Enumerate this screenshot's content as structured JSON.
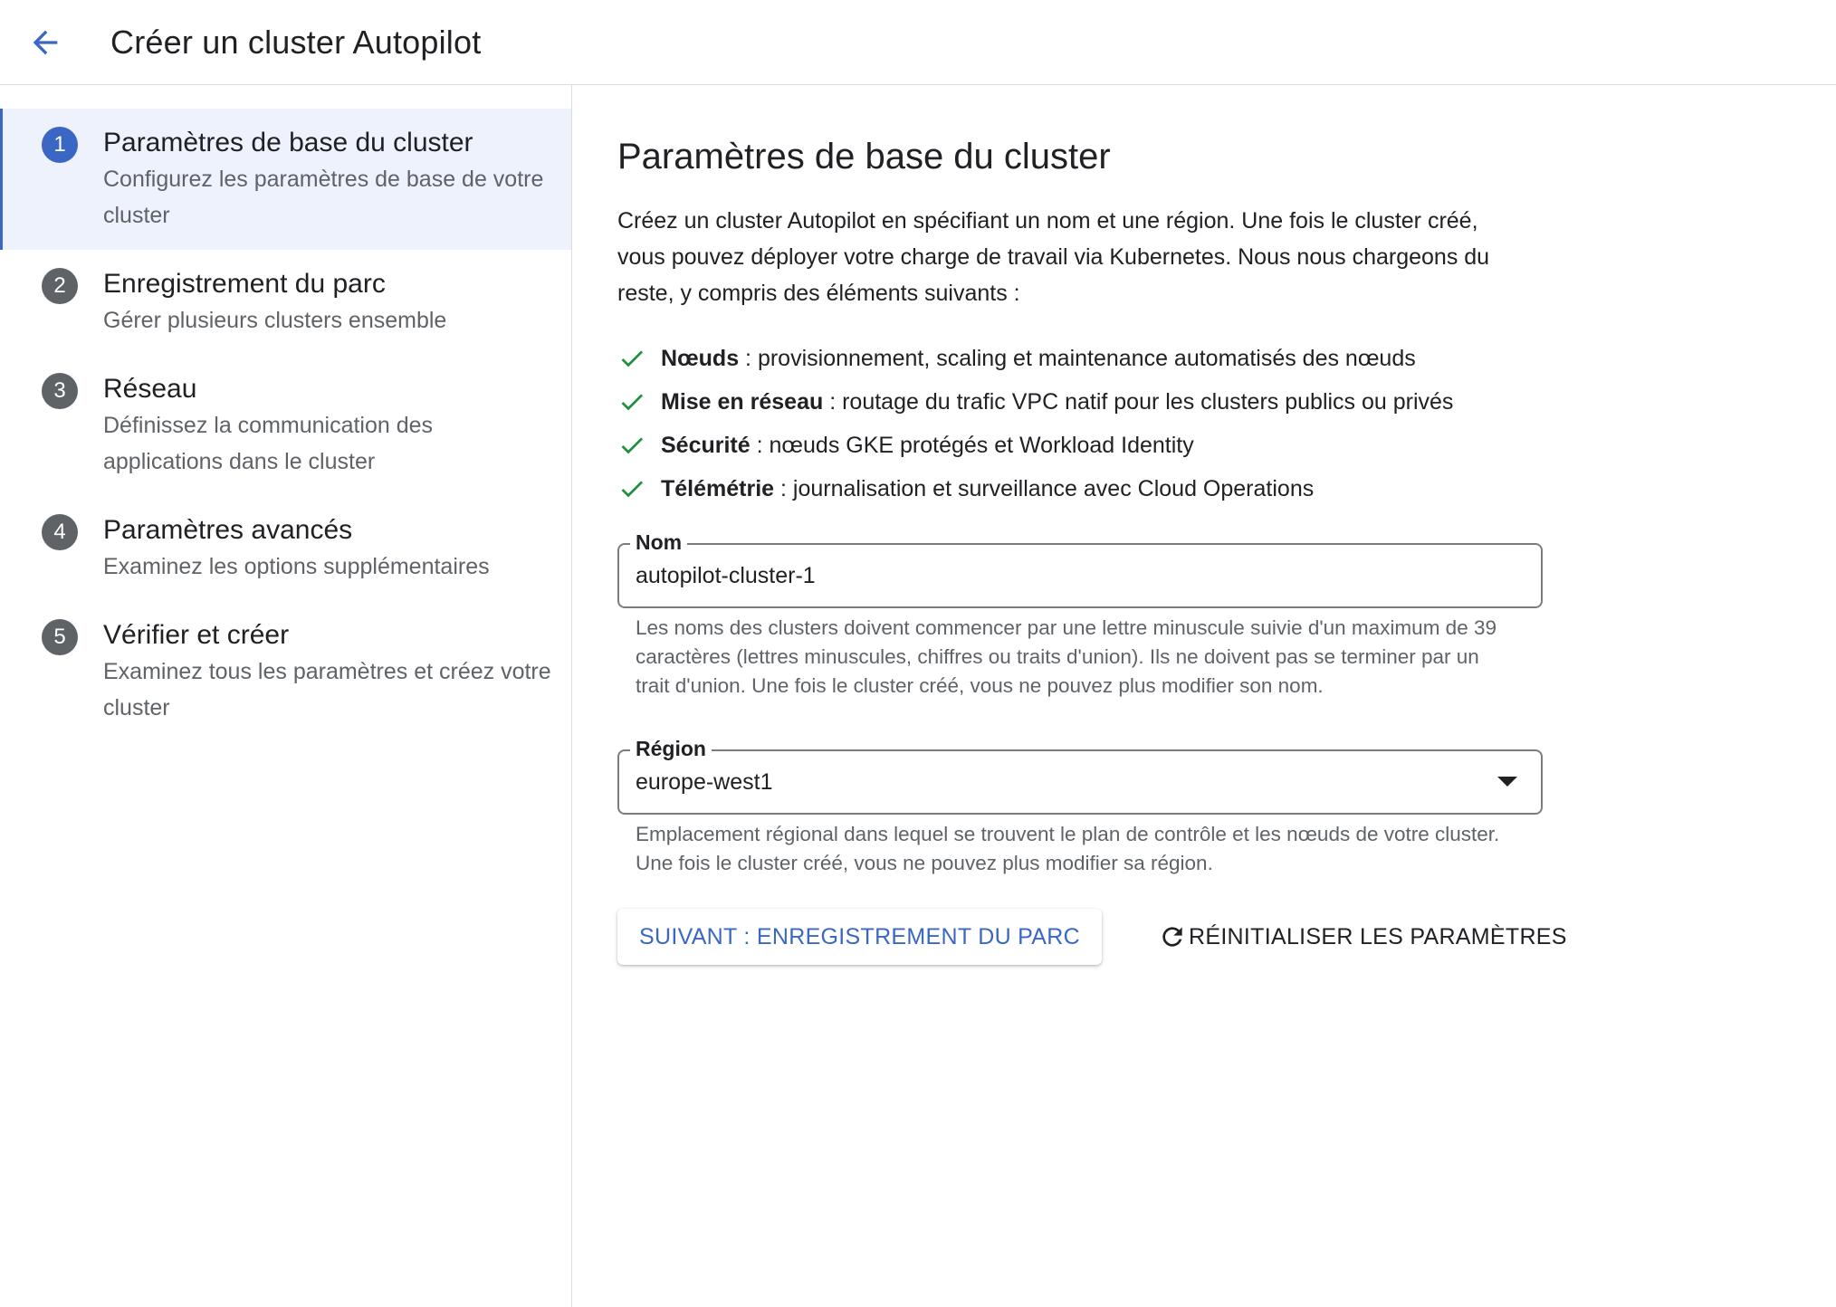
{
  "header": {
    "title": "Créer un cluster Autopilot",
    "back_icon": "arrow-back-icon"
  },
  "colors": {
    "accent": "#3b67c4",
    "check": "#1e8e3e",
    "active_bg": "#edf2fc"
  },
  "steps": [
    {
      "num": "1",
      "title": "Paramètres de base du cluster",
      "subtitle": "Configurez les paramètres de base de votre cluster",
      "active": true
    },
    {
      "num": "2",
      "title": "Enregistrement du parc",
      "subtitle": "Gérer plusieurs clusters ensemble",
      "active": false
    },
    {
      "num": "3",
      "title": "Réseau",
      "subtitle": "Définissez la communication des applications dans le cluster",
      "active": false
    },
    {
      "num": "4",
      "title": "Paramètres avancés",
      "subtitle": "Examinez les options supplémentaires",
      "active": false
    },
    {
      "num": "5",
      "title": "Vérifier et créer",
      "subtitle": "Examinez tous les paramètres et créez votre cluster",
      "active": false
    }
  ],
  "main": {
    "heading": "Paramètres de base du cluster",
    "intro": "Créez un cluster Autopilot en spécifiant un nom et une région. Une fois le cluster créé, vous pouvez déployer votre charge de travail via Kubernetes. Nous nous chargeons du reste, y compris des éléments suivants :",
    "features": [
      {
        "bold": "Nœuds",
        "text": " : provisionnement, scaling et maintenance automatisés des nœuds"
      },
      {
        "bold": "Mise en réseau",
        "text": " : routage du trafic VPC natif pour les clusters publics ou privés"
      },
      {
        "bold": "Sécurité",
        "text": " : nœuds GKE protégés et Workload Identity"
      },
      {
        "bold": "Télémétrie",
        "text": " : journalisation et surveillance avec Cloud Operations"
      }
    ],
    "name_field": {
      "label": "Nom",
      "value": "autopilot-cluster-1",
      "helper": "Les noms des clusters doivent commencer par une lettre minuscule suivie d'un maximum de 39 caractères (lettres minuscules, chiffres ou traits d'union). Ils ne doivent pas se terminer par un trait d'union. Une fois le cluster créé, vous ne pouvez plus modifier son nom."
    },
    "region_field": {
      "label": "Région",
      "value": "europe-west1",
      "helper": "Emplacement régional dans lequel se trouvent le plan de contrôle et les nœuds de votre cluster. Une fois le cluster créé, vous ne pouvez plus modifier sa région."
    },
    "next_button": "SUIVANT : ENREGISTREMENT DU PARC",
    "reset_button": "RÉINITIALISER LES PARAMÈTRES"
  }
}
